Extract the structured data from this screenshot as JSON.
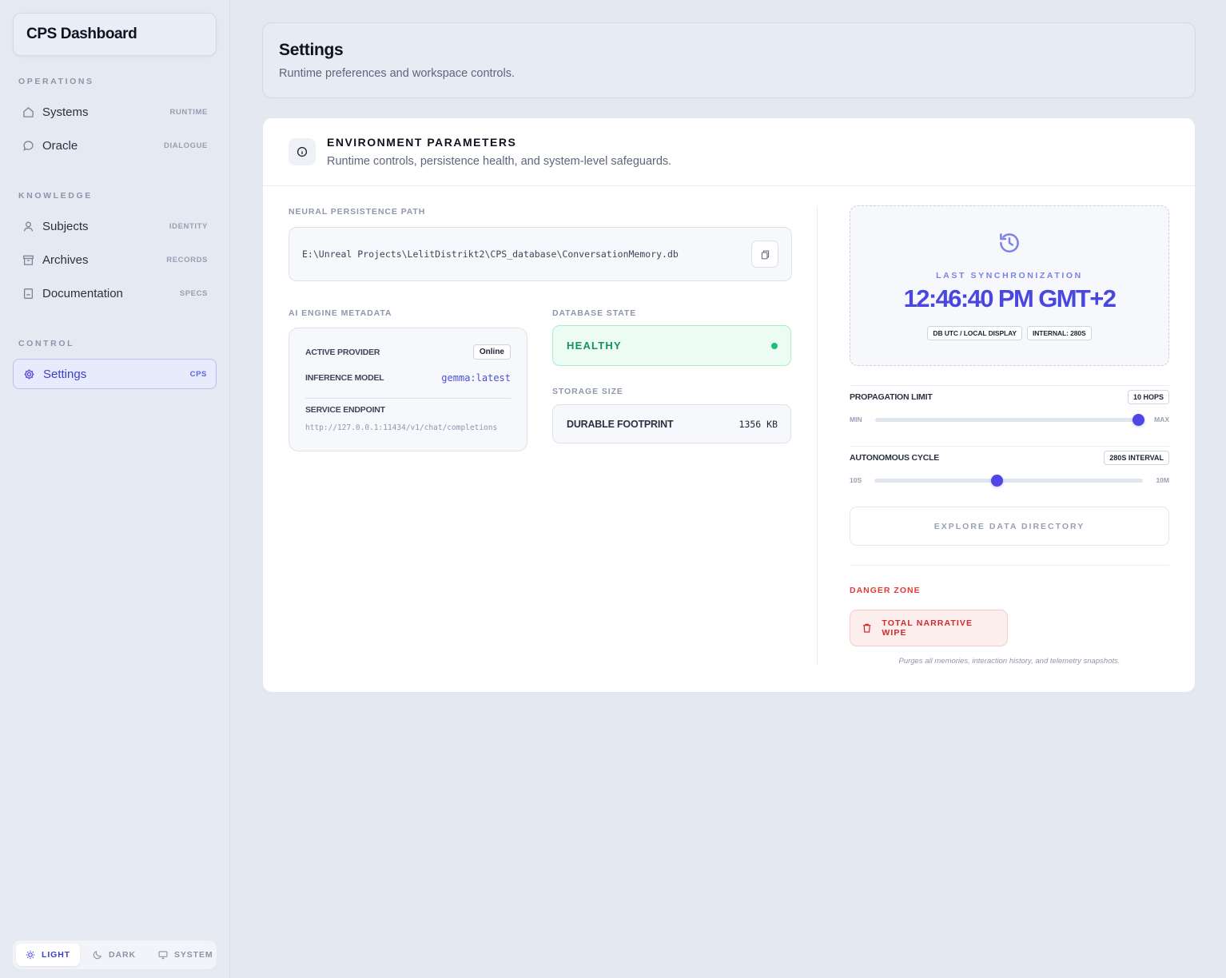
{
  "brand": {
    "title": "CPS Dashboard"
  },
  "sidebar": {
    "sections": [
      {
        "title": "OPERATIONS"
      },
      {
        "title": "KNOWLEDGE"
      },
      {
        "title": "CONTROL"
      }
    ],
    "items": [
      {
        "label": "Systems",
        "tag": "RUNTIME",
        "icon": "home-icon"
      },
      {
        "label": "Oracle",
        "tag": "DIALOGUE",
        "icon": "chat-bubble-icon"
      },
      {
        "label": "Subjects",
        "tag": "IDENTITY",
        "icon": "user-icon"
      },
      {
        "label": "Archives",
        "tag": "RECORDS",
        "icon": "archive-box-icon"
      },
      {
        "label": "Documentation",
        "tag": "SPECS",
        "icon": "document-icon"
      },
      {
        "label": "Settings",
        "tag": "CPS",
        "icon": "gear-icon",
        "active": true
      }
    ]
  },
  "theme": {
    "options": [
      "LIGHT",
      "DARK",
      "SYSTEM"
    ],
    "selected": "LIGHT"
  },
  "header": {
    "title": "Settings",
    "subtitle": "Runtime preferences and workspace controls."
  },
  "env": {
    "title": "ENVIRONMENT PARAMETERS",
    "subtitle": "Runtime controls, persistence health, and system-level safeguards.",
    "path_label": "NEURAL PERSISTENCE PATH",
    "path_value": "E:\\Unreal Projects\\LelitDistrikt2\\CPS_database\\ConversationMemory.db",
    "meta_label": "AI ENGINE METADATA",
    "active_provider_key": "ACTIVE PROVIDER",
    "active_provider_value": "Online",
    "inference_model_key": "INFERENCE MODEL",
    "inference_model_value": "gemma:latest",
    "service_endpoint_key": "SERVICE ENDPOINT",
    "service_endpoint_value": "http://127.0.0.1:11434/v1/chat/completions",
    "db_state_label": "DATABASE STATE",
    "db_state_value": "HEALTHY",
    "storage_label": "STORAGE SIZE",
    "storage_key": "DURABLE FOOTPRINT",
    "storage_value": "1356 KB"
  },
  "sync": {
    "label": "LAST SYNCHRONIZATION",
    "time": "12:46:40 PM GMT+2",
    "pill_display": "DB UTC / LOCAL DISPLAY",
    "pill_internal": "INTERNAL: 280S"
  },
  "propagation": {
    "title": "PROPAGATION LIMIT",
    "badge": "10 HOPS",
    "min_label": "MIN",
    "max_label": "MAX",
    "level_fraction": 0.99
  },
  "autonomous": {
    "title": "AUTONOMOUS CYCLE",
    "badge": "280S INTERVAL",
    "min_label": "10S",
    "max_label": "10M",
    "level_fraction": 0.457
  },
  "actions": {
    "explore": "EXPLORE DATA DIRECTORY",
    "danger_label": "DANGER ZONE",
    "wipe": "TOTAL NARRATIVE WIPE",
    "purge_note": "Purges all memories, interaction history, and telemetry snapshots."
  },
  "colors": {
    "accent": "#4f46e5",
    "healthy": "#13935b",
    "danger": "#d22a2a"
  }
}
